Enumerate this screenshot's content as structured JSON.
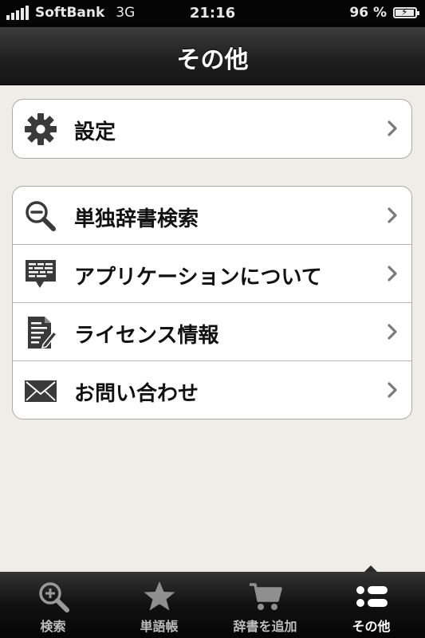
{
  "status_bar": {
    "carrier": "SoftBank",
    "network": "3G",
    "time": "21:16",
    "battery": "96 %",
    "battery_level": 0.96
  },
  "nav": {
    "title": "その他"
  },
  "groups": [
    {
      "items": [
        {
          "label": "設定",
          "icon": "gear-icon"
        }
      ]
    },
    {
      "items": [
        {
          "label": "単独辞書検索",
          "icon": "zoom-out-icon"
        },
        {
          "label": "アプリケーションについて",
          "icon": "speech-bubble-icon"
        },
        {
          "label": "ライセンス情報",
          "icon": "document-edit-icon"
        },
        {
          "label": "お問い合わせ",
          "icon": "envelope-icon"
        }
      ]
    }
  ],
  "tabs": [
    {
      "label": "検索",
      "icon": "search-plus-icon",
      "active": false
    },
    {
      "label": "単語帳",
      "icon": "star-icon",
      "active": false
    },
    {
      "label": "辞書を追加",
      "icon": "cart-icon",
      "active": false
    },
    {
      "label": "その他",
      "icon": "more-list-icon",
      "active": true
    }
  ],
  "colors": {
    "background": "#efede7",
    "nav_bar": "#1e1e1e",
    "tab_bar": "#111111",
    "icon": "#3a3a3a",
    "chevron": "#7a7a7a"
  }
}
